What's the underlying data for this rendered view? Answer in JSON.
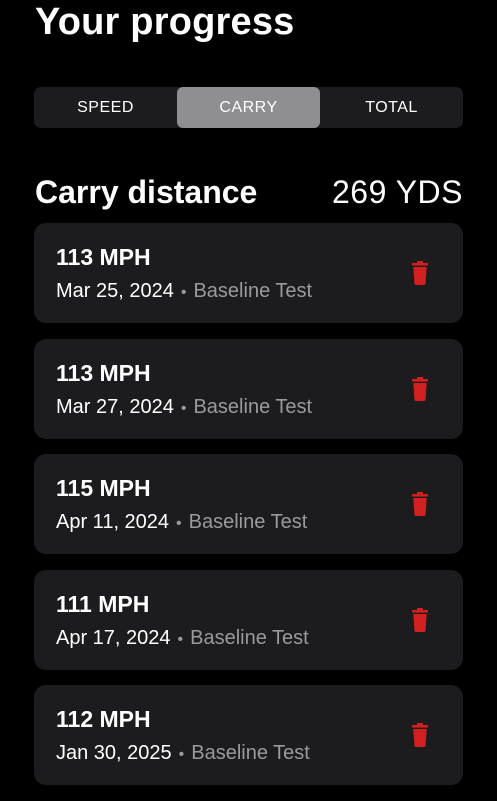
{
  "page": {
    "title": "Your progress"
  },
  "tabs": [
    {
      "label": "SPEED",
      "active": false
    },
    {
      "label": "CARRY",
      "active": true
    },
    {
      "label": "TOTAL",
      "active": false
    }
  ],
  "section": {
    "title": "Carry distance",
    "value": "269 YDS"
  },
  "entries": [
    {
      "speed": "113 MPH",
      "date": "Mar 25, 2024",
      "type": "Baseline Test",
      "delete_icon": "trash-icon"
    },
    {
      "speed": "113 MPH",
      "date": "Mar 27, 2024",
      "type": "Baseline Test",
      "delete_icon": "trash-icon"
    },
    {
      "speed": "115 MPH",
      "date": "Apr 11, 2024",
      "type": "Baseline Test",
      "delete_icon": "trash-icon"
    },
    {
      "speed": "111 MPH",
      "date": "Apr 17, 2024",
      "type": "Baseline Test",
      "delete_icon": "trash-icon"
    },
    {
      "speed": "112 MPH",
      "date": "Jan 30, 2025",
      "type": "Baseline Test",
      "delete_icon": "trash-icon"
    }
  ],
  "separator": "•",
  "colors": {
    "background": "#000000",
    "card": "#1c1c1e",
    "active_tab": "#8e8e93",
    "delete": "#d21f1f",
    "muted_text": "#9a9a9e"
  }
}
